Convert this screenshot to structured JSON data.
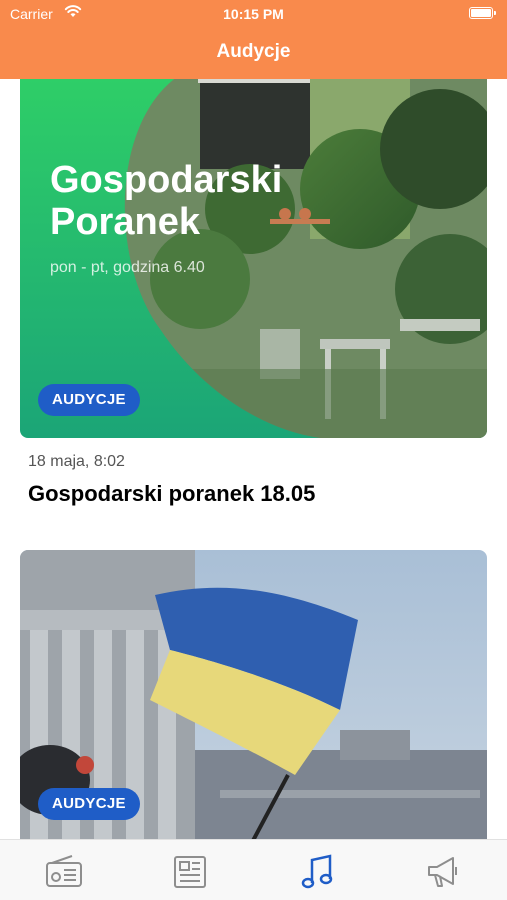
{
  "status_bar": {
    "carrier": "Carrier",
    "time": "10:15 PM"
  },
  "nav": {
    "title": "Audycje"
  },
  "cards": [
    {
      "promo_title_line1": "Gospodarski",
      "promo_title_line2": "Poranek",
      "promo_subtitle": "pon - pt, godzina 6.40",
      "badge": "AUDYCJE",
      "meta": "18 maja, 8:02",
      "headline": "Gospodarski poranek 18.05"
    },
    {
      "badge": "AUDYCJE"
    }
  ],
  "tabs": [
    {
      "icon": "radio-icon",
      "active": false
    },
    {
      "icon": "newspaper-icon",
      "active": false
    },
    {
      "icon": "music-note-icon",
      "active": true
    },
    {
      "icon": "megaphone-icon",
      "active": false
    }
  ],
  "colors": {
    "accent": "#f98a4c",
    "badge": "#1f5dc7",
    "tab_active": "#1f5dc7",
    "tab_inactive": "#8e8e8e"
  }
}
